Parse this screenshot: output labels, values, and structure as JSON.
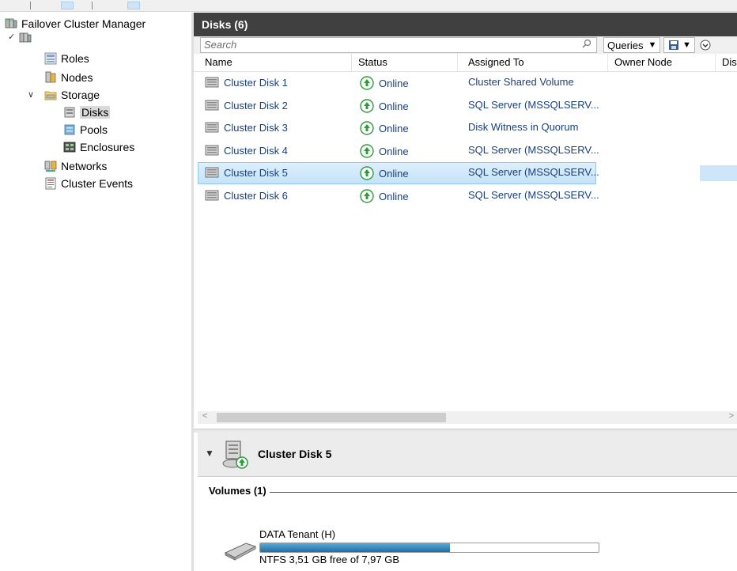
{
  "tree": {
    "root": "Failover Cluster Manager",
    "items": [
      {
        "label": "Roles"
      },
      {
        "label": "Nodes"
      },
      {
        "label": "Storage"
      },
      {
        "label": "Disks"
      },
      {
        "label": "Pools"
      },
      {
        "label": "Enclosures"
      },
      {
        "label": "Networks"
      },
      {
        "label": "Cluster Events"
      }
    ]
  },
  "main": {
    "title": "Disks (6)",
    "search_placeholder": "Search",
    "queries_label": "Queries",
    "columns": [
      "Name",
      "Status",
      "Assigned To",
      "Owner Node",
      "Dis"
    ],
    "rows": [
      {
        "name": "Cluster Disk 1",
        "status": "Online",
        "assigned": "Cluster Shared Volume"
      },
      {
        "name": "Cluster Disk 2",
        "status": "Online",
        "assigned": "SQL Server (MSSQLSERV..."
      },
      {
        "name": "Cluster Disk 3",
        "status": "Online",
        "assigned": "Disk Witness in Quorum"
      },
      {
        "name": "Cluster Disk 4",
        "status": "Online",
        "assigned": "SQL Server (MSSQLSERV..."
      },
      {
        "name": "Cluster Disk 5",
        "status": "Online",
        "assigned": "SQL Server (MSSQLSERV..."
      },
      {
        "name": "Cluster Disk 6",
        "status": "Online",
        "assigned": "SQL Server (MSSQLSERV..."
      }
    ],
    "selected_row": 4
  },
  "detail": {
    "title": "Cluster Disk 5",
    "volumes_header": "Volumes (1)",
    "volume": {
      "label": "DATA Tenant (H)",
      "stats": "NTFS 3,51 GB free of 7,97 GB",
      "used_fraction": 0.56
    }
  },
  "colors": {
    "header_bg": "#404040",
    "link_text": "#1a3f78",
    "online_green": "#2e9c3a",
    "selection": "#cde6f9"
  }
}
